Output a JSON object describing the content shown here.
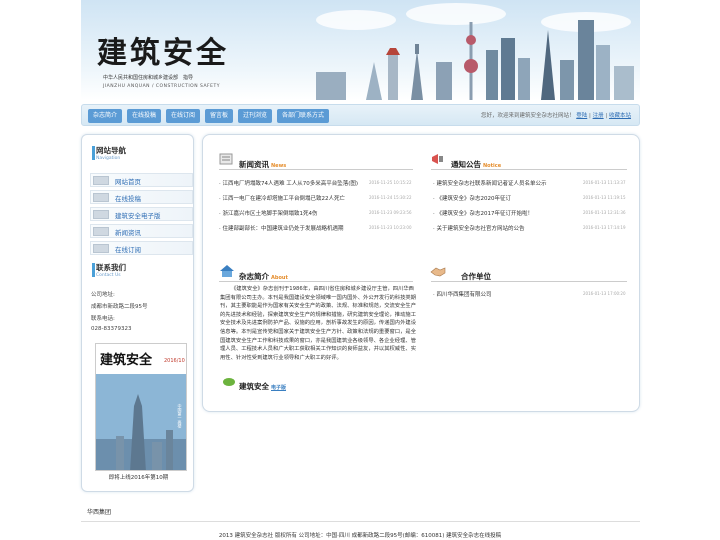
{
  "header": {
    "logo_text": "建筑安全",
    "sub1": "中华人民共和国住房和城乡建设部　指导",
    "sub2": "JIANZHU  ANQUAN / CONSTRUCTION SAFETY"
  },
  "nav": {
    "items": [
      "杂志简介",
      "在线投稿",
      "在线订阅",
      "留言板",
      "过刊浏览",
      "各部门联系方式"
    ],
    "welcome": "您好，欢迎来到建筑安全杂志社网站！",
    "login": "登陆",
    "sep": "|",
    "register": "注册",
    "sep2": "|",
    "favorite": "收藏本站"
  },
  "left": {
    "nav_title": "网站导航",
    "nav_sub": "Navigation",
    "nav_items": [
      "网站首页",
      "在线投稿",
      "建筑安全电子版",
      "新闻资讯",
      "在线订阅"
    ],
    "contact_title": "联系我们",
    "contact_sub": "Contact Us",
    "addr_label": "公司地址:",
    "addr": "成都市新政路二段95号",
    "phone_label": "联系电话:",
    "phone": "028-83379323",
    "cover_caption": "即将上线2016年第10期",
    "cover": {
      "logo": "建筑安全",
      "issue": "2016/10",
      "vertical": "中国第一高楼"
    }
  },
  "news": {
    "title": "新闻资讯",
    "title_en": "News",
    "items": [
      {
        "text": "江西电厂坍塌致74人遇难 工人从70多米高平台坠落(图)",
        "date": "2016-11-25 10:15:22"
      },
      {
        "text": "江西一电厂在建冷却塔施工平台倒塌已致22人死亡",
        "date": "2016-11-24 15:30:22"
      },
      {
        "text": "浙江嘉兴市区土地脚手架倒塌致1死4伤",
        "date": "2016-11-23 09:23:56"
      },
      {
        "text": "住建部副部长：中国建筑业仍处于发展战略机遇期",
        "date": "2016-11-23 10:23:00"
      }
    ]
  },
  "notice": {
    "title": "通知公告",
    "title_en": "Notice",
    "items": [
      {
        "text": "建筑安全杂志社联系新闻记者证人员名单公示",
        "date": "2016-01-13 11:13:37"
      },
      {
        "text": "《建筑安全》杂志2020年征订",
        "date": "2016-01-13 11:19:15"
      },
      {
        "text": "《建筑安全》杂志2017年征订开始啦！",
        "date": "2016-01-13 12:31:36"
      },
      {
        "text": "关于建筑安全杂志社官方网站的公告",
        "date": "2016-01-13 17:14:19"
      }
    ]
  },
  "about": {
    "title": "杂志简介",
    "title_en": "About",
    "text": "《建筑安全》杂志创刊于1986年，由四川省住房和城乡建设厅主管，四川华西集团有限公司主办。本刊是我国建设安全领域唯一国内国外、外公开发行的科技类期刊，其主要职能是作为国家有关安全生产的政策、法规、标准和规范，交流安全生产的先进技术和经验，探索建筑安全生产的规律和措施，研究建筑安全理论，推动施工安全技术及先进案例防护产品、设施的应用，剖析事故发生的原因，传递国内外建设信息等。本刊是宣传党和国家关于建筑安全生产方针、政策和法规的重要窗口，是全国建筑安全生产工作和科技成果的窗口，亦是我国建筑业各级领导、各企业经理、管理人员、工程技术人员和广大职工获取相关工作知识的良师益友，并以其权威性、实用性、针对性受到建筑行业领导和广大职工的好评。"
  },
  "partner": {
    "title": "合作单位",
    "items": [
      {
        "text": "四川华西集团有限公司",
        "date": "2016-01-13 17:00:20"
      }
    ]
  },
  "ebook": {
    "title": "建筑安全",
    "title_em": "电子版"
  },
  "footer": {
    "link": "华西集团",
    "copyright": "2013 建筑安全杂志社 版权所有 公司地址：中国·四川 成都新政路二段95号(邮编：610081) 建筑安全杂志在线投稿"
  }
}
